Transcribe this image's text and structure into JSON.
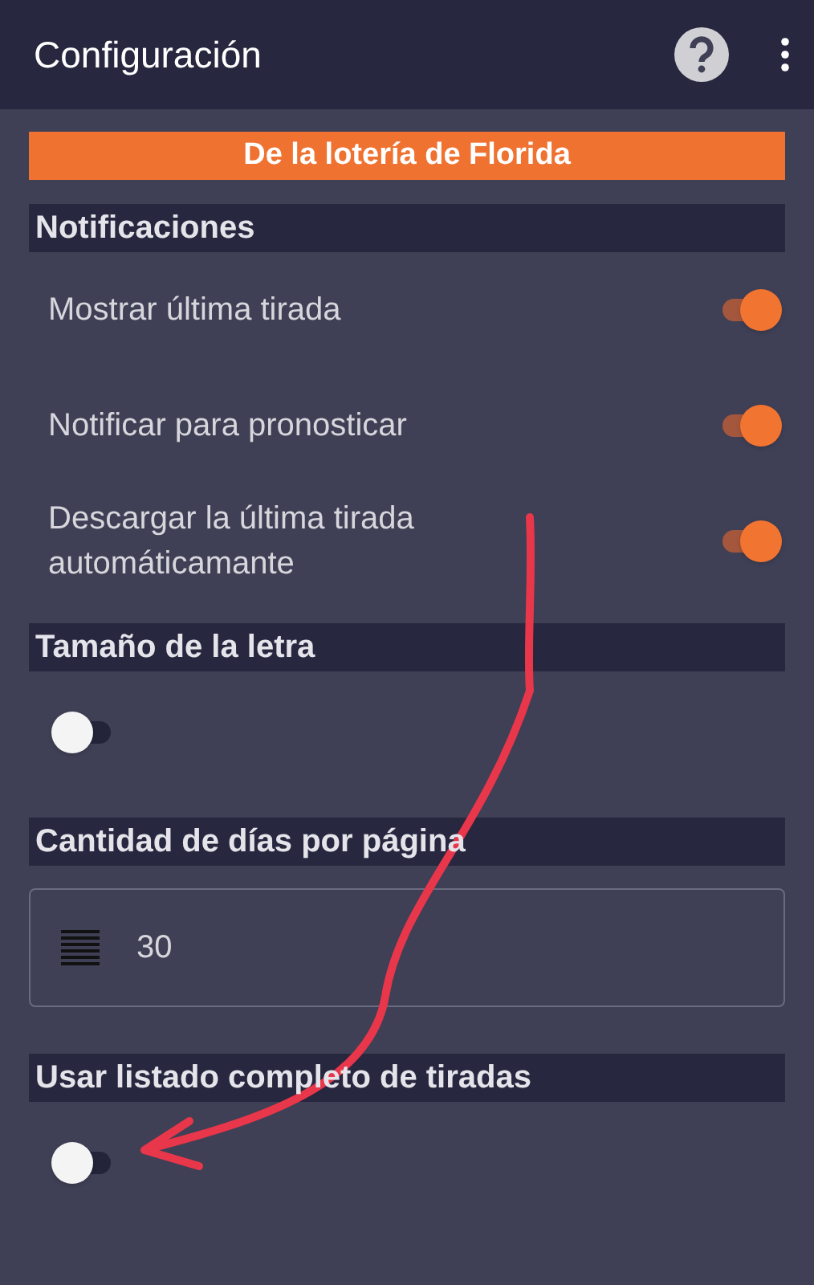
{
  "app_bar": {
    "title": "Configuración"
  },
  "banner": "De la lotería de Florida",
  "sections": [
    {
      "title": "Notificaciones",
      "items": [
        {
          "kind": "switch",
          "label": "Mostrar última tirada",
          "on": true
        },
        {
          "kind": "switch",
          "label": "Notificar para pronosticar",
          "on": true
        },
        {
          "kind": "switch",
          "label": "Descargar la última tirada automáticamante",
          "on": true
        }
      ]
    },
    {
      "title": "Tamaño de la letra",
      "items": [
        {
          "kind": "switch",
          "on": false
        }
      ]
    },
    {
      "title": "Cantidad de días por página",
      "items": [
        {
          "kind": "field",
          "value": "30"
        }
      ]
    },
    {
      "title": "Usar listado completo de tiradas",
      "items": [
        {
          "kind": "switch",
          "on": false
        }
      ]
    }
  ]
}
